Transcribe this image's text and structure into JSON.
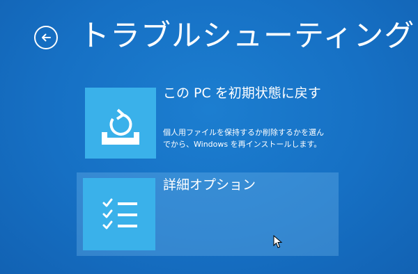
{
  "header": {
    "back_icon": "arrow-left-circle-icon",
    "title": "トラブルシューティング"
  },
  "options": [
    {
      "icon": "reset-pc-icon",
      "title": "この PC を初期状態に戻す",
      "description": "個人用ファイルを保持するか削除するかを選んでから、Windows を再インストールします。"
    },
    {
      "icon": "checklist-icon",
      "title": "詳細オプション"
    }
  ],
  "colors": {
    "background": "#1670c4",
    "tile": "#3ab1ea",
    "selected_highlight": "#5fa6e0"
  },
  "cursor_icon": "mouse-pointer-icon"
}
